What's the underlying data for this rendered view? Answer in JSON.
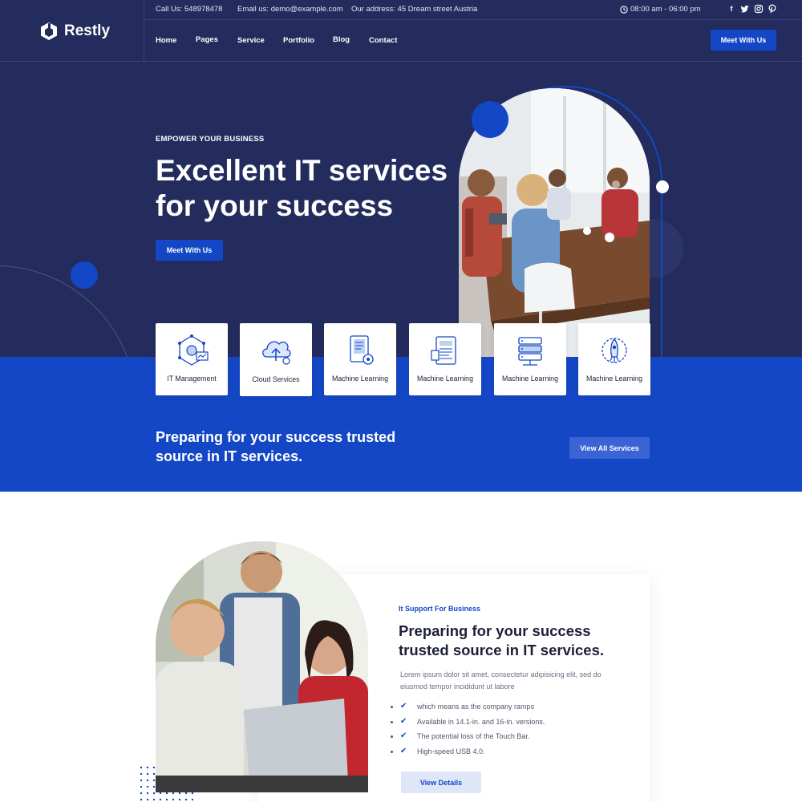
{
  "brand": {
    "name": "Restly"
  },
  "topbar": {
    "phone": "Call Us: 548978478",
    "email": "Email us: demo@example.com",
    "address": "Our address: 45 Dream street Austria",
    "hours": "08:00 am - 06:00 pm",
    "social": [
      "facebook-icon",
      "twitter-icon",
      "instagram-icon",
      "pinterest-icon"
    ]
  },
  "nav": {
    "items": [
      "Home",
      "Pages",
      "Service",
      "Portfolio",
      "Blog",
      "Contact"
    ],
    "cta": "Meet With Us"
  },
  "hero": {
    "eyebrow": "EMPOWER YOUR BUSINESS",
    "title": "Excellent IT services for your success",
    "cta": "Meet With Us"
  },
  "services": [
    {
      "label": "IT Management",
      "icon": "network-analytics-icon"
    },
    {
      "label": "Cloud Services",
      "icon": "cloud-upload-icon"
    },
    {
      "label": "Machine Learning",
      "icon": "tablet-gear-icon"
    },
    {
      "label": "Machine Learning",
      "icon": "report-document-icon"
    },
    {
      "label": "Machine Learning",
      "icon": "server-stack-icon"
    },
    {
      "label": "Machine Learning",
      "icon": "rocket-gear-icon"
    }
  ],
  "band": {
    "title": "Preparing for your success trusted source in IT services.",
    "cta": "View All Services"
  },
  "about": {
    "eyebrow": "It Support For Business",
    "title": "Preparing for your success trusted source in IT services.",
    "text": "Lorem ipsum dolor sit amet, consectetur adipisicing elit, sed do eiusmod tempor incididunt ut labore",
    "checklist": [
      "which means as the company ramps",
      "Available in 14.1-in. and 16-in. versions.",
      "The potential loss of the Touch Bar.",
      "High-speed USB 4.0."
    ],
    "cta": "View Details"
  },
  "colors": {
    "navy": "#232c5c",
    "accent": "#1447c6",
    "white": "#ffffff"
  }
}
